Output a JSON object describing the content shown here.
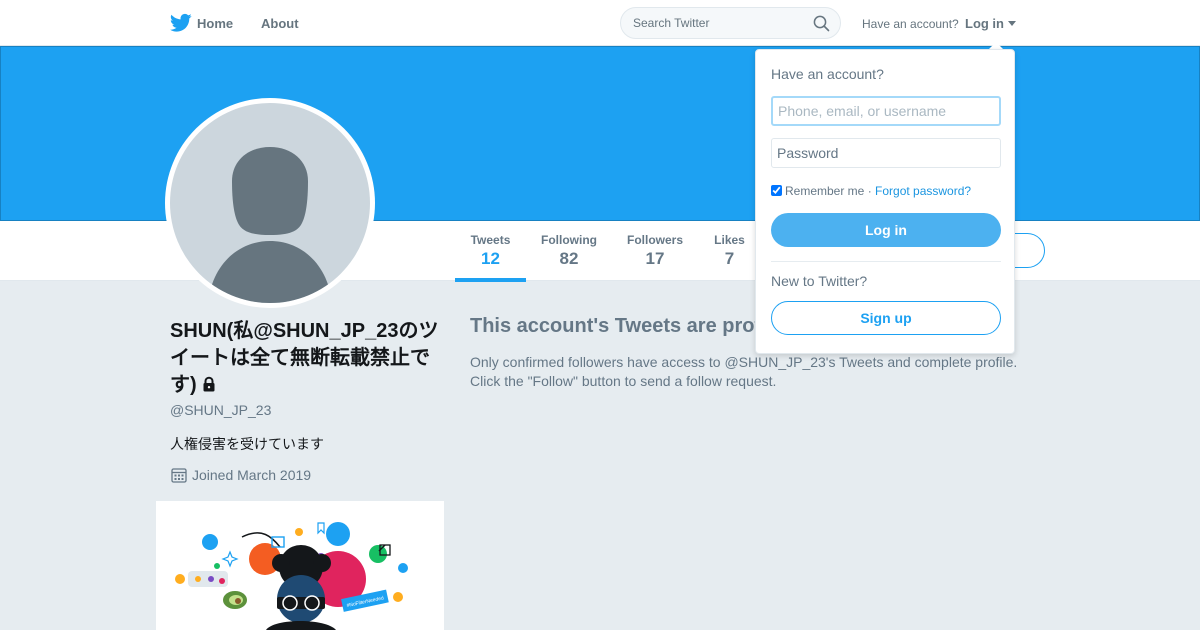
{
  "nav": {
    "home_label": "Home",
    "about_label": "About",
    "search_placeholder": "Search Twitter",
    "have_account": "Have an account?",
    "login_label": "Log in",
    "bird_icon": "twitter-bird-icon"
  },
  "colors": {
    "brand_blue": "#1da1f2",
    "banner": "#1da1f2",
    "page_bg": "#e6ecf0",
    "avatar_bg": "#ccd6dd",
    "avatar_figure": "#657786"
  },
  "profile": {
    "name": "SHUN(私@SHUN_JP_23のツイートは全て無断転載禁止です)",
    "handle": "@SHUN_JP_23",
    "bio": "人権侵害を受けています",
    "joined": "Joined March 2019"
  },
  "stats": [
    {
      "label": "Tweets",
      "value": "12",
      "active": true
    },
    {
      "label": "Following",
      "value": "82",
      "active": false
    },
    {
      "label": "Followers",
      "value": "17",
      "active": false
    },
    {
      "label": "Likes",
      "value": "7",
      "active": false
    }
  ],
  "protected": {
    "title": "This account's Tweets are protected.",
    "line1": "Only confirmed followers have access to @SHUN_JP_23's Tweets and complete profile.",
    "line2": "Click the \"Follow\" button to send a follow request."
  },
  "login_dropdown": {
    "heading": "Have an account?",
    "username_placeholder": "Phone, email, or username",
    "password_placeholder": "Password",
    "remember_label": "Remember me",
    "remember_checked": true,
    "separator": " · ",
    "forgot_label": "Forgot password?",
    "login_button": "Log in",
    "new_prompt": "New to Twitter?",
    "signup_button": "Sign up"
  },
  "promo": {
    "sticker_text": "#NoFilterNeeded"
  }
}
